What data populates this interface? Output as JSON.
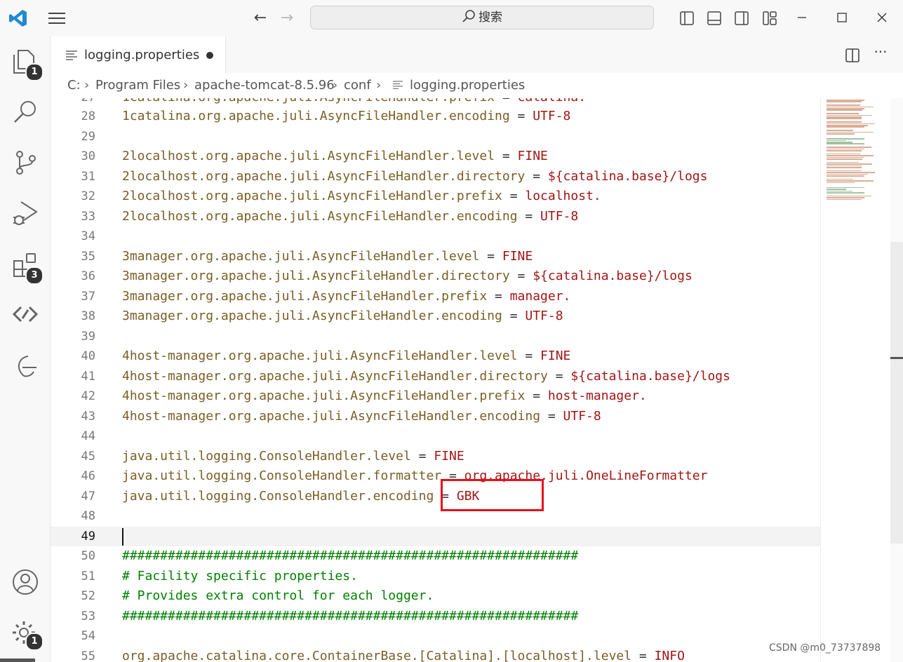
{
  "titlebar": {
    "search_placeholder": "搜索"
  },
  "activity": {
    "explorer_badge": "1",
    "extensions_badge": "3",
    "settings_badge": "1"
  },
  "tab": {
    "label": "logging.properties"
  },
  "breadcrumb": [
    "C:",
    "Program Files",
    "apache-tomcat-8.5.96",
    "conf",
    "logging.properties"
  ],
  "editor": {
    "current_line": 49,
    "lines": [
      {
        "n": "28",
        "key": "1catalina.org.apache.juli.AsyncFileHandler.encoding",
        "val": "UTF-8"
      },
      {
        "n": "29"
      },
      {
        "n": "30",
        "key": "2localhost.org.apache.juli.AsyncFileHandler.level",
        "val": "FINE"
      },
      {
        "n": "31",
        "key": "2localhost.org.apache.juli.AsyncFileHandler.directory",
        "val": "${catalina.base}/logs"
      },
      {
        "n": "32",
        "key": "2localhost.org.apache.juli.AsyncFileHandler.prefix",
        "val": "localhost."
      },
      {
        "n": "33",
        "key": "2localhost.org.apache.juli.AsyncFileHandler.encoding",
        "val": "UTF-8"
      },
      {
        "n": "34"
      },
      {
        "n": "35",
        "key": "3manager.org.apache.juli.AsyncFileHandler.level",
        "val": "FINE"
      },
      {
        "n": "36",
        "key": "3manager.org.apache.juli.AsyncFileHandler.directory",
        "val": "${catalina.base}/logs"
      },
      {
        "n": "37",
        "key": "3manager.org.apache.juli.AsyncFileHandler.prefix",
        "val": "manager."
      },
      {
        "n": "38",
        "key": "3manager.org.apache.juli.AsyncFileHandler.encoding",
        "val": "UTF-8"
      },
      {
        "n": "39"
      },
      {
        "n": "40",
        "key": "4host-manager.org.apache.juli.AsyncFileHandler.level",
        "val": "FINE"
      },
      {
        "n": "41",
        "key": "4host-manager.org.apache.juli.AsyncFileHandler.directory",
        "val": "${catalina.base}/logs"
      },
      {
        "n": "42",
        "key": "4host-manager.org.apache.juli.AsyncFileHandler.prefix",
        "val": "host-manager."
      },
      {
        "n": "43",
        "key": "4host-manager.org.apache.juli.AsyncFileHandler.encoding",
        "val": "UTF-8"
      },
      {
        "n": "44"
      },
      {
        "n": "45",
        "key": "java.util.logging.ConsoleHandler.level",
        "val": "FINE"
      },
      {
        "n": "46",
        "key": "java.util.logging.ConsoleHandler.formatter",
        "val": "org.apache.juli.OneLineFormatter"
      },
      {
        "n": "47",
        "key": "java.util.logging.ConsoleHandler.encoding",
        "val": "GBK"
      },
      {
        "n": "48"
      },
      {
        "n": "49"
      },
      {
        "n": "50",
        "comment": "############################################################"
      },
      {
        "n": "51",
        "comment": "# Facility specific properties."
      },
      {
        "n": "52",
        "comment": "# Provides extra control for each logger."
      },
      {
        "n": "53",
        "comment": "############################################################"
      },
      {
        "n": "54"
      },
      {
        "n": "55",
        "key": "org.apache.catalina.core.ContainerBase.[Catalina].[localhost].level",
        "val": "INFO"
      }
    ]
  },
  "watermark": "CSDN @m0_73737898"
}
